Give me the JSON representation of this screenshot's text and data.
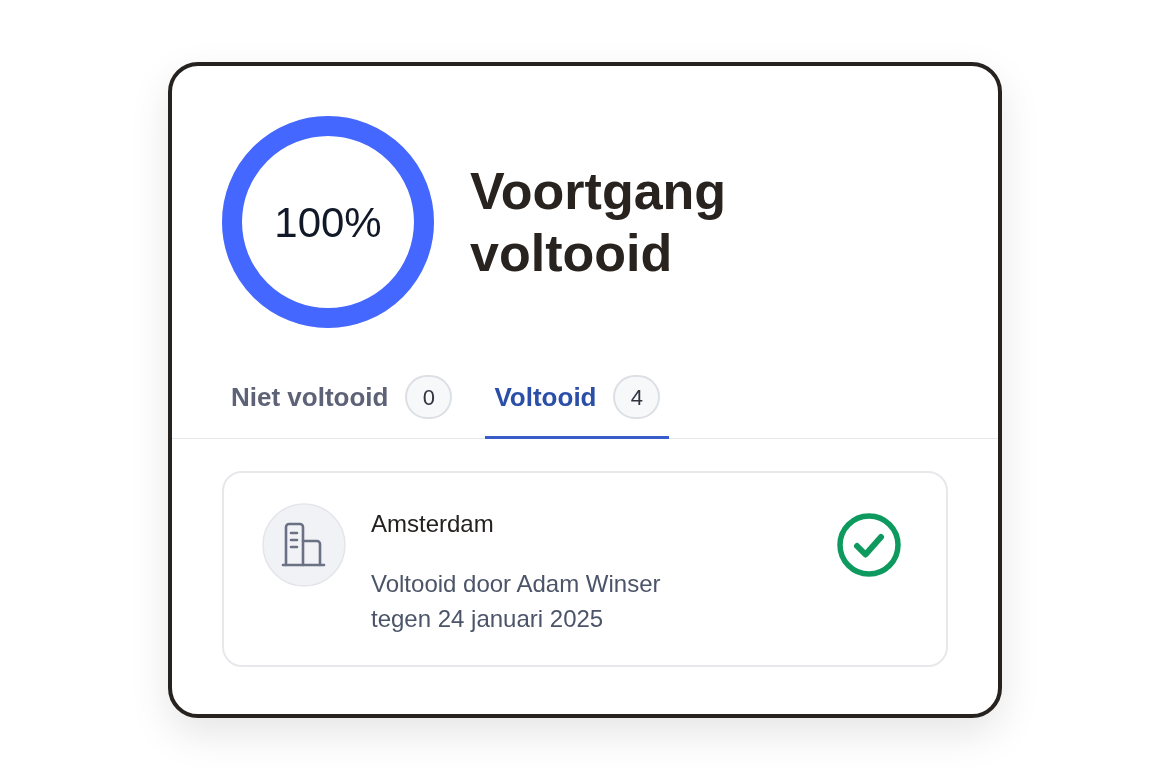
{
  "progress": {
    "label": "100%",
    "level": 1
  },
  "title": "Voortgang voltooid",
  "tabs": [
    {
      "label": "Niet voltooid",
      "count": "0",
      "selected": false
    },
    {
      "label": "Voltooid",
      "count": "4",
      "selected": true
    }
  ],
  "items": [
    {
      "title": "Amsterdam",
      "description": "Voltooid door Adam Winser tegen 24 januari 2025",
      "done": true
    }
  ]
}
